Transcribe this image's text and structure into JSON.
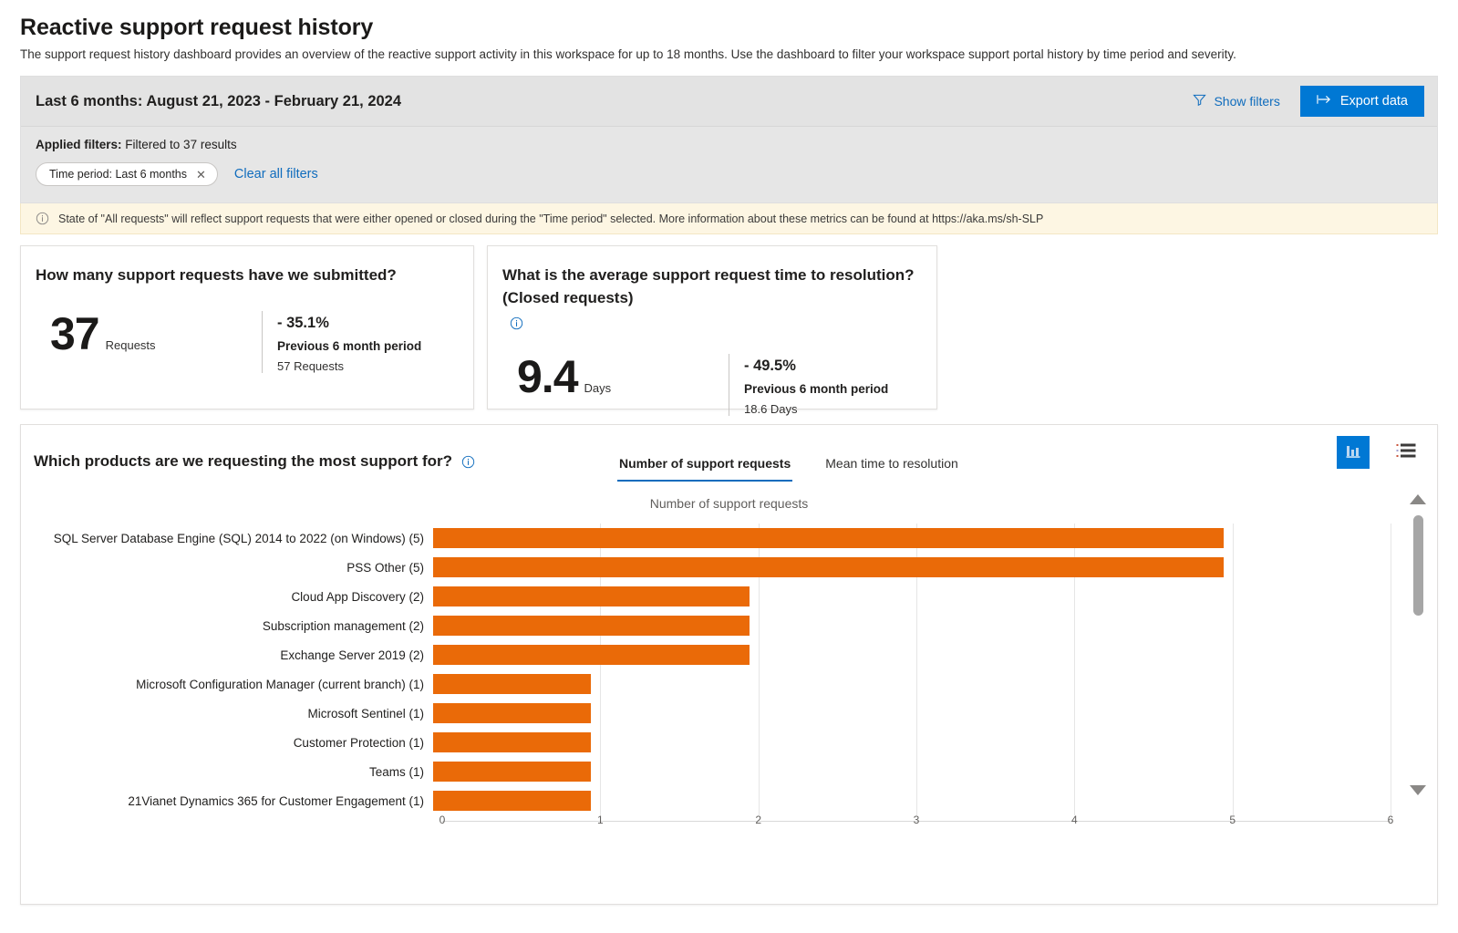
{
  "page": {
    "title": "Reactive support request history",
    "description": "The support request history dashboard provides an overview of the reactive support activity in this workspace for up to 18 months. Use the dashboard to filter your workspace support portal history by time period and severity."
  },
  "filters": {
    "range_label": "Last 6 months: August 21, 2023 - February 21, 2024",
    "show_filters_label": "Show filters",
    "export_label": "Export data",
    "applied_label": "Applied filters:",
    "applied_summary": "Filtered to 37 results",
    "chips": [
      {
        "label": "Time period: Last 6 months",
        "close": "✕"
      }
    ],
    "clear_all_label": "Clear all filters"
  },
  "banner": {
    "text": "State of \"All requests\" will reflect support requests that were either opened or closed during the \"Time period\" selected. More information about these metrics can be found at https://aka.ms/sh-SLP"
  },
  "kpis": [
    {
      "title": "How many support requests have we submitted?",
      "has_info_icon": false,
      "value": "37",
      "unit": "Requests",
      "delta": "- 35.1%",
      "period_label": "Previous 6 month period",
      "previous_value": "57 Requests"
    },
    {
      "title": "What is the average support request time to resolution?(Closed requests)",
      "has_info_icon": true,
      "value": "9.4",
      "unit": "Days",
      "delta": "- 49.5%",
      "period_label": "Previous 6 month period",
      "previous_value": "18.6 Days"
    }
  ],
  "chart_panel": {
    "title": "Which products are we requesting the most support for?",
    "tabs": [
      {
        "label": "Number of support requests",
        "active": true
      },
      {
        "label": "Mean time to resolution",
        "active": false
      }
    ],
    "view_buttons": [
      {
        "name": "chart-view",
        "icon": "bar-chart-icon",
        "active": true
      },
      {
        "name": "table-view",
        "icon": "list-view-icon",
        "active": false
      }
    ]
  },
  "chart_data": {
    "type": "bar",
    "orientation": "horizontal",
    "title": "Number of support requests",
    "xlabel": "",
    "ylabel": "",
    "xlim": [
      0,
      6
    ],
    "xticks": [
      0,
      1,
      2,
      3,
      4,
      5,
      6
    ],
    "grid": true,
    "bar_color": "#ea6a08",
    "categories": [
      "SQL Server  Database Engine (SQL)  2014 to 2022 (on Windows) (5)",
      "PSS Other (5)",
      "Cloud App Discovery (2)",
      "Subscription management (2)",
      "Exchange Server 2019 (2)",
      "Microsoft Configuration Manager (current branch) (1)",
      "Microsoft Sentinel (1)",
      "Customer Protection (1)",
      "Teams (1)",
      "21Vianet Dynamics 365 for Customer Engagement (1)"
    ],
    "values": [
      5,
      5,
      2,
      2,
      2,
      1,
      1,
      1,
      1,
      1
    ]
  },
  "scrollbar": {
    "up_arrow": "▲",
    "down_arrow": "▼"
  }
}
